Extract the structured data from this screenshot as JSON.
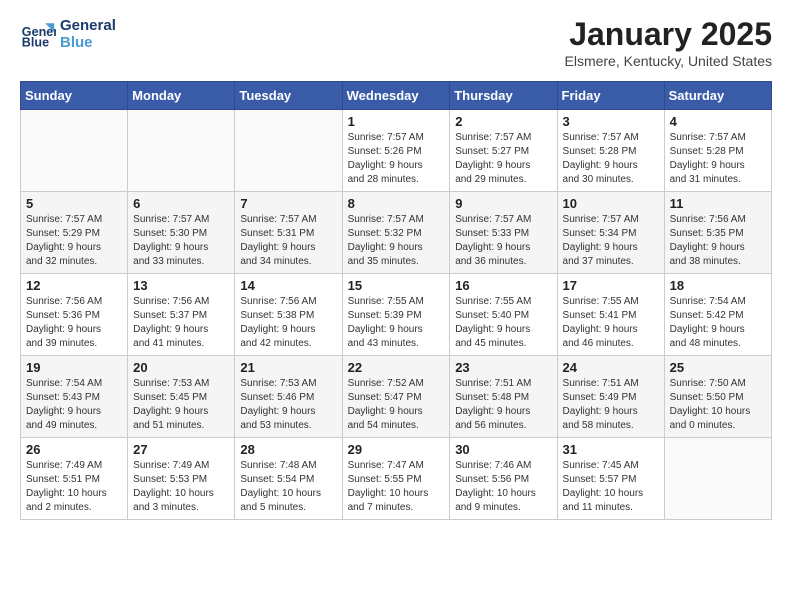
{
  "header": {
    "logo_line1": "General",
    "logo_line2": "Blue",
    "month": "January 2025",
    "location": "Elsmere, Kentucky, United States"
  },
  "weekdays": [
    "Sunday",
    "Monday",
    "Tuesday",
    "Wednesday",
    "Thursday",
    "Friday",
    "Saturday"
  ],
  "weeks": [
    [
      {
        "day": "",
        "info": ""
      },
      {
        "day": "",
        "info": ""
      },
      {
        "day": "",
        "info": ""
      },
      {
        "day": "1",
        "info": "Sunrise: 7:57 AM\nSunset: 5:26 PM\nDaylight: 9 hours\nand 28 minutes."
      },
      {
        "day": "2",
        "info": "Sunrise: 7:57 AM\nSunset: 5:27 PM\nDaylight: 9 hours\nand 29 minutes."
      },
      {
        "day": "3",
        "info": "Sunrise: 7:57 AM\nSunset: 5:28 PM\nDaylight: 9 hours\nand 30 minutes."
      },
      {
        "day": "4",
        "info": "Sunrise: 7:57 AM\nSunset: 5:28 PM\nDaylight: 9 hours\nand 31 minutes."
      }
    ],
    [
      {
        "day": "5",
        "info": "Sunrise: 7:57 AM\nSunset: 5:29 PM\nDaylight: 9 hours\nand 32 minutes."
      },
      {
        "day": "6",
        "info": "Sunrise: 7:57 AM\nSunset: 5:30 PM\nDaylight: 9 hours\nand 33 minutes."
      },
      {
        "day": "7",
        "info": "Sunrise: 7:57 AM\nSunset: 5:31 PM\nDaylight: 9 hours\nand 34 minutes."
      },
      {
        "day": "8",
        "info": "Sunrise: 7:57 AM\nSunset: 5:32 PM\nDaylight: 9 hours\nand 35 minutes."
      },
      {
        "day": "9",
        "info": "Sunrise: 7:57 AM\nSunset: 5:33 PM\nDaylight: 9 hours\nand 36 minutes."
      },
      {
        "day": "10",
        "info": "Sunrise: 7:57 AM\nSunset: 5:34 PM\nDaylight: 9 hours\nand 37 minutes."
      },
      {
        "day": "11",
        "info": "Sunrise: 7:56 AM\nSunset: 5:35 PM\nDaylight: 9 hours\nand 38 minutes."
      }
    ],
    [
      {
        "day": "12",
        "info": "Sunrise: 7:56 AM\nSunset: 5:36 PM\nDaylight: 9 hours\nand 39 minutes."
      },
      {
        "day": "13",
        "info": "Sunrise: 7:56 AM\nSunset: 5:37 PM\nDaylight: 9 hours\nand 41 minutes."
      },
      {
        "day": "14",
        "info": "Sunrise: 7:56 AM\nSunset: 5:38 PM\nDaylight: 9 hours\nand 42 minutes."
      },
      {
        "day": "15",
        "info": "Sunrise: 7:55 AM\nSunset: 5:39 PM\nDaylight: 9 hours\nand 43 minutes."
      },
      {
        "day": "16",
        "info": "Sunrise: 7:55 AM\nSunset: 5:40 PM\nDaylight: 9 hours\nand 45 minutes."
      },
      {
        "day": "17",
        "info": "Sunrise: 7:55 AM\nSunset: 5:41 PM\nDaylight: 9 hours\nand 46 minutes."
      },
      {
        "day": "18",
        "info": "Sunrise: 7:54 AM\nSunset: 5:42 PM\nDaylight: 9 hours\nand 48 minutes."
      }
    ],
    [
      {
        "day": "19",
        "info": "Sunrise: 7:54 AM\nSunset: 5:43 PM\nDaylight: 9 hours\nand 49 minutes."
      },
      {
        "day": "20",
        "info": "Sunrise: 7:53 AM\nSunset: 5:45 PM\nDaylight: 9 hours\nand 51 minutes."
      },
      {
        "day": "21",
        "info": "Sunrise: 7:53 AM\nSunset: 5:46 PM\nDaylight: 9 hours\nand 53 minutes."
      },
      {
        "day": "22",
        "info": "Sunrise: 7:52 AM\nSunset: 5:47 PM\nDaylight: 9 hours\nand 54 minutes."
      },
      {
        "day": "23",
        "info": "Sunrise: 7:51 AM\nSunset: 5:48 PM\nDaylight: 9 hours\nand 56 minutes."
      },
      {
        "day": "24",
        "info": "Sunrise: 7:51 AM\nSunset: 5:49 PM\nDaylight: 9 hours\nand 58 minutes."
      },
      {
        "day": "25",
        "info": "Sunrise: 7:50 AM\nSunset: 5:50 PM\nDaylight: 10 hours\nand 0 minutes."
      }
    ],
    [
      {
        "day": "26",
        "info": "Sunrise: 7:49 AM\nSunset: 5:51 PM\nDaylight: 10 hours\nand 2 minutes."
      },
      {
        "day": "27",
        "info": "Sunrise: 7:49 AM\nSunset: 5:53 PM\nDaylight: 10 hours\nand 3 minutes."
      },
      {
        "day": "28",
        "info": "Sunrise: 7:48 AM\nSunset: 5:54 PM\nDaylight: 10 hours\nand 5 minutes."
      },
      {
        "day": "29",
        "info": "Sunrise: 7:47 AM\nSunset: 5:55 PM\nDaylight: 10 hours\nand 7 minutes."
      },
      {
        "day": "30",
        "info": "Sunrise: 7:46 AM\nSunset: 5:56 PM\nDaylight: 10 hours\nand 9 minutes."
      },
      {
        "day": "31",
        "info": "Sunrise: 7:45 AM\nSunset: 5:57 PM\nDaylight: 10 hours\nand 11 minutes."
      },
      {
        "day": "",
        "info": ""
      }
    ]
  ]
}
